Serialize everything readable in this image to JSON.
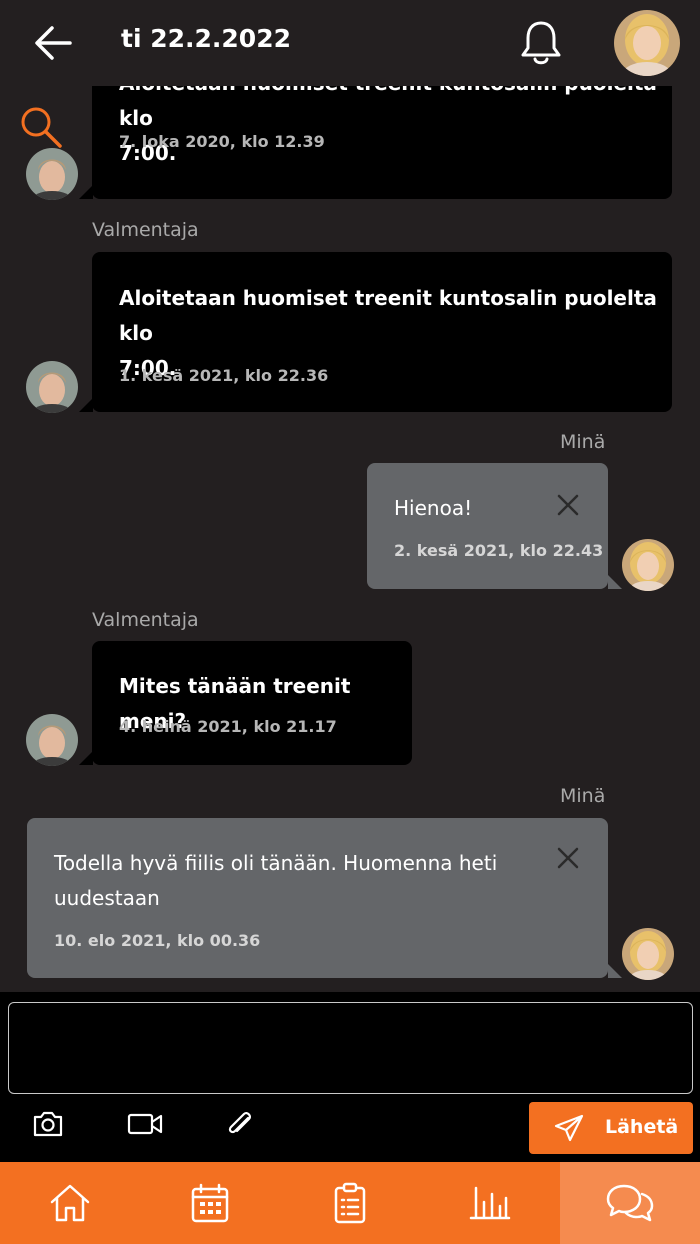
{
  "header": {
    "title": "ti 22.2.2022"
  },
  "messages": [
    {
      "sender": "",
      "text_lines": [
        "Aloitetaan huomiset treenit kuntosalin puolelta klo",
        "7:00."
      ],
      "time": "7. loka 2020, klo 12.39"
    },
    {
      "sender": "Valmentaja",
      "text_lines": [
        "Aloitetaan huomiset treenit kuntosalin puolelta klo",
        "7:00."
      ],
      "time": "1. kesä 2021, klo 22.36"
    },
    {
      "sender": "Minä",
      "text_lines": [
        "Hienoa!"
      ],
      "time": "2. kesä 2021, klo 22.43"
    },
    {
      "sender": "Valmentaja",
      "text_lines": [
        "Mites tänään treenit meni?"
      ],
      "time": "4. heinä 2021, klo 21.17"
    },
    {
      "sender": "Minä",
      "text_lines": [
        "Todella hyvä fiilis oli tänään. Huomenna heti",
        "uudestaan"
      ],
      "time": "10. elo 2021, klo 00.36"
    }
  ],
  "composer": {
    "input_value": "",
    "send_label": "Lähetä",
    "tools": [
      "camera-icon",
      "video-icon",
      "paperclip-icon"
    ]
  },
  "nav": {
    "items": [
      "home-icon",
      "calendar-icon",
      "clipboard-icon",
      "bar-chart-icon",
      "chat-icon"
    ],
    "active": "chat-icon"
  },
  "colors": {
    "accent": "#f37021",
    "background": "#231f20",
    "coach_bubble": "#000000",
    "my_bubble": "#646669"
  }
}
